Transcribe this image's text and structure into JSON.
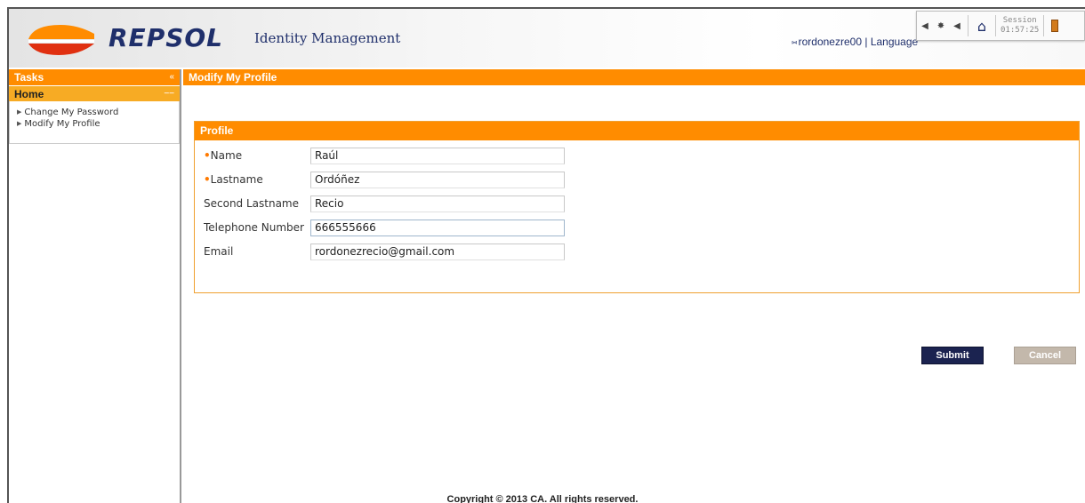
{
  "header": {
    "brand": "REPSOL",
    "app_title": "Identity Management",
    "user_name": "rordonezre00",
    "separator": "|",
    "language_label": "Language",
    "brand_colors": {
      "orange": "#ff8c00",
      "navy": "#1f2f6b",
      "red": "#e03010"
    }
  },
  "toolbar": {
    "icons": [
      "arrow-left-icon",
      "gear-icon",
      "arrow-right-icon",
      "home-icon",
      "logout-icon"
    ],
    "session_label": "Session",
    "session_time": "01:57:25"
  },
  "sidebar": {
    "tasks_label": "Tasks",
    "collapse_glyph": "«",
    "home_label": "Home",
    "items": [
      {
        "label": "Change My Password"
      },
      {
        "label": "Modify My Profile"
      }
    ]
  },
  "main": {
    "title": "Modify My Profile",
    "profile": {
      "heading": "Profile",
      "fields": [
        {
          "label": "Name",
          "required": true,
          "value": "Raúl"
        },
        {
          "label": "Lastname",
          "required": true,
          "value": "Ordóñez"
        },
        {
          "label": "Second Lastname",
          "required": false,
          "value": "Recio"
        },
        {
          "label": "Telephone Number",
          "required": false,
          "value": "666555666"
        },
        {
          "label": "Email",
          "required": false,
          "value": "rordonezrecio@gmail.com"
        }
      ]
    },
    "submit_label": "Submit",
    "cancel_label": "Cancel"
  },
  "footer": {
    "copyright": "Copyright © 2013 CA. All rights reserved."
  }
}
